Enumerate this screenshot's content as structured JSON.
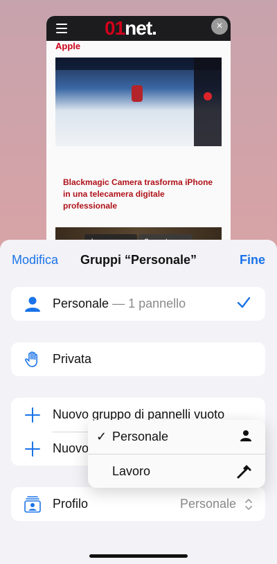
{
  "background_tab": {
    "brand": {
      "red_part": "01",
      "white_part": "net."
    },
    "category": "Apple",
    "headline": "Blackmagic Camera trasforma iPhone in una telecamera digitale professionale",
    "image2_input": "Jaguar",
    "image2_button": "Generate"
  },
  "sheet": {
    "edit_label": "Modifica",
    "title": "Gruppi “Personale”",
    "done_label": "Fine"
  },
  "groups": {
    "personal": {
      "label": "Personale",
      "detail": " — 1 pannello",
      "icon": "person-icon"
    },
    "private": {
      "label": "Privata",
      "icon": "hand-raised-icon"
    },
    "new_empty": {
      "label": "Nuovo gruppo di pannelli vuoto",
      "icon": "plus-icon"
    },
    "new_partial": {
      "label": "Nuovo",
      "icon": "plus-icon"
    },
    "profile": {
      "label": "Profilo",
      "value": "Personale",
      "icon": "profile-icon"
    }
  },
  "profile_menu": {
    "items": [
      {
        "label": "Personale",
        "checked": true,
        "icon": "person-icon"
      },
      {
        "label": "Lavoro",
        "checked": false,
        "icon": "hammer-icon"
      }
    ],
    "check_glyph": "✓"
  },
  "colors": {
    "accent": "#1a73e8",
    "brand_red": "#d0021b"
  }
}
